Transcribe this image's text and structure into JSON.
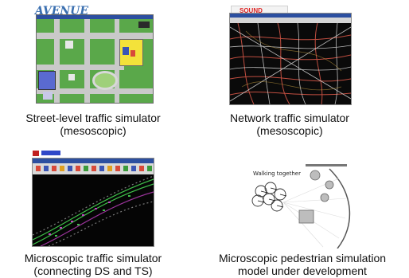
{
  "panels": [
    {
      "id": "street-level",
      "logo_text": "AVENUE",
      "caption_line1": "Street-level traffic simulator",
      "caption_line2": "(mesoscopic)"
    },
    {
      "id": "network",
      "logo_text": "SOUND",
      "caption_line1": "Network traffic simulator",
      "caption_line2": "(mesoscopic)"
    },
    {
      "id": "microscopic-traffic",
      "caption_line1": "Microscopic traffic simulator",
      "caption_line2": "(connecting DS and TS)"
    },
    {
      "id": "pedestrian",
      "diagram_label": "Walking together",
      "caption_line1": "Microscopic pedestrian simulation",
      "caption_line2": "model under development"
    }
  ],
  "colors": {
    "map_green": "#5aa84a",
    "road_gray": "#c9c9c9",
    "title_blue": "#2c4fa0",
    "network_red": "#e05a4a",
    "network_white": "#e8e8e8",
    "micro_green": "#3fbf4a",
    "micro_magenta": "#c040c0"
  }
}
